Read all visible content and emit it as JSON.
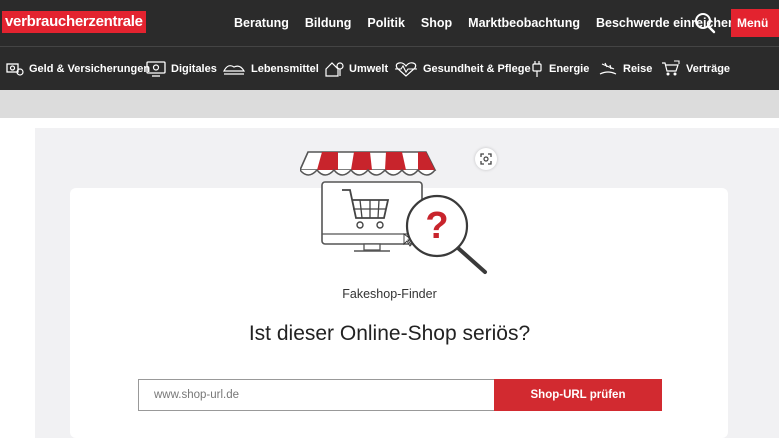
{
  "header": {
    "logo_text": "verbraucherzentrale",
    "nav": [
      "Beratung",
      "Bildung",
      "Politik",
      "Shop",
      "Marktbeobachtung",
      "Beschwerde einreichen"
    ],
    "menu_label": "Menü",
    "accent_color": "#e3232f"
  },
  "categories": [
    {
      "label": "Geld & Versicherungen",
      "icon": "money-icon"
    },
    {
      "label": "Digitales",
      "icon": "monitor-icon"
    },
    {
      "label": "Lebensmittel",
      "icon": "food-icon"
    },
    {
      "label": "Umwelt",
      "icon": "house-tree-icon"
    },
    {
      "label": "Gesundheit & Pflege",
      "icon": "heart-pulse-icon"
    },
    {
      "label": "Energie",
      "icon": "plug-icon"
    },
    {
      "label": "Reise",
      "icon": "travel-icon"
    },
    {
      "label": "Verträge",
      "icon": "cart-contract-icon"
    }
  ],
  "finder": {
    "eyebrow": "Fakeshop-Finder",
    "headline": "Ist dieser Online-Shop seriös?",
    "input_placeholder": "www.shop-url.de",
    "input_value": "",
    "button_label": "Shop-URL prüfen",
    "button_color": "#d22a30"
  }
}
